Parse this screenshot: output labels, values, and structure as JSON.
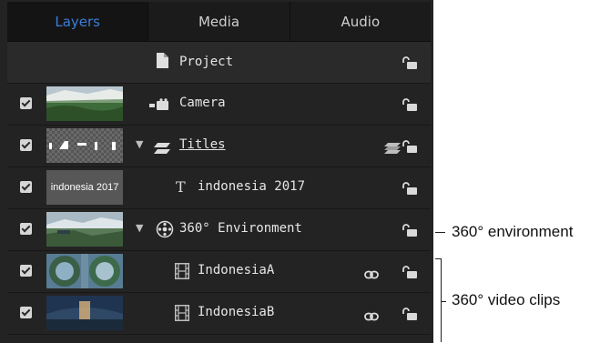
{
  "tabs": [
    {
      "label": "Layers",
      "active": true
    },
    {
      "label": "Media",
      "active": false
    },
    {
      "label": "Audio",
      "active": false
    }
  ],
  "colors": {
    "active_tab": "#3d7dd6",
    "panel_bg": "#232323",
    "row_bg": "#232323"
  },
  "layers": [
    {
      "name": "Project",
      "icon": "document-icon",
      "checkbox": false,
      "expanded": null
    },
    {
      "name": "Camera",
      "icon": "camera-icon",
      "checkbox": true,
      "expanded": null
    },
    {
      "name": "Titles",
      "icon": "titles-group-icon",
      "checkbox": true,
      "expanded": true
    },
    {
      "name": "indonesia 2017",
      "icon": "text-icon",
      "checkbox": true,
      "expanded": null,
      "thumb_text": "indonesia 2017"
    },
    {
      "name": "360° Environment",
      "icon": "environment-360-icon",
      "checkbox": true,
      "expanded": true
    },
    {
      "name": "IndonesiaA",
      "icon": "film-strip-icon",
      "checkbox": true,
      "expanded": null
    },
    {
      "name": "IndonesiaB",
      "icon": "film-strip-icon",
      "checkbox": true,
      "expanded": null
    }
  ],
  "callouts": {
    "environment": "360° environment",
    "video_clips": "360° video clips"
  }
}
